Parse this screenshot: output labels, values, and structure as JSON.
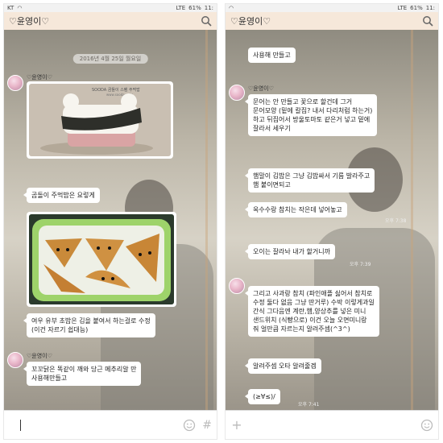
{
  "left": {
    "status": {
      "carrier": "KT",
      "network": "LTE",
      "battery": "61%",
      "time": "11:"
    },
    "title": "♡윤영이♡",
    "date": "2016년 4월 25일 월요일",
    "sender_name": "♡윤영이♡",
    "photo1_caption": "SOODA 곰돌이 스팸 주먹밥",
    "photo1_url": "www.sooda.or.kr",
    "messages": [
      "곰돌이 주먹밥은 요렇게",
      "여우 유부 초밥은 김을 붙여서 하는걸로 수정\n(이건 자르기 쉽대능)",
      "꼬꼬닭은 똑같이 깨와 당근 메추리알 만\n사용해만들고"
    ],
    "sender_name_2": "♡윤영이♡"
  },
  "right": {
    "status": {
      "network": "LTE",
      "battery": "61%",
      "time": "11:"
    },
    "title": "♡윤영이♡",
    "top_partial": "사용해 만들고",
    "sender_name": "♡윤영이♡",
    "messages": [
      "문어는 안 만들고 꽃으로 할건데 그거\n문어모양 (밑에 칼집? 내서 다리처럼 하는거)\n하고 뒤집어서 방울토마토 같은거 넣고 밑에\n잘라서 세우기",
      "햄말이 김밥은 그냥 김밥싸서 기름 발라주고\n햄 붙이면되고",
      "옥수수랑 참치는 작은데 넣어놓고",
      "오이는 잘라놔 내가 할거니까",
      "그리고 사과랑 참치 (파인애플 싫어서 참치로\n수정 둘다 없음 그냥 딴거루) 수박 이렇게과일\n간식 그다음엔 계란,햄,양상추를 넣은 미니\n샌드위치 (식빵으로) 이건 오늘 오면미니랑\n줘 얼만큼 자르는지 알려주셈(^3^)",
      "알려주셈 오타 알려줄겜",
      "(≥∀≤)/"
    ],
    "times": [
      "오후 7:38",
      "오후 7:39",
      "오후 7:41"
    ]
  },
  "icons": [
    "search-icon",
    "emoji-icon",
    "plus-icon",
    "hash-icon"
  ]
}
